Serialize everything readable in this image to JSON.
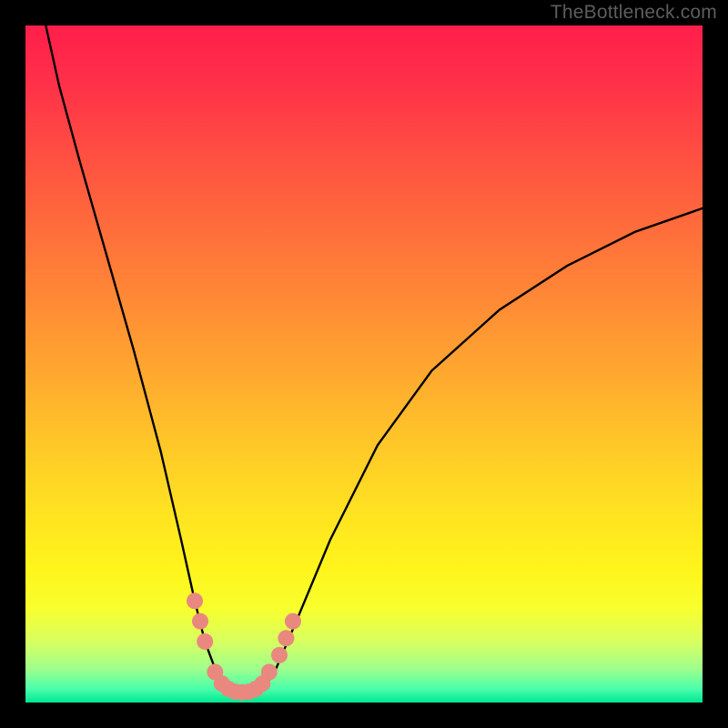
{
  "watermark": "TheBottleneck.com",
  "chart_data": {
    "type": "line",
    "title": "",
    "xlabel": "",
    "ylabel": "",
    "xlim": [
      0,
      100
    ],
    "ylim": [
      0,
      100
    ],
    "series": [
      {
        "name": "bottleneck-curve",
        "x": [
          3,
          5,
          8,
          12,
          16,
          20,
          23,
          25,
          26.5,
          28,
          29.5,
          31,
          32.5,
          34,
          35.5,
          37,
          40,
          45,
          52,
          60,
          70,
          80,
          90,
          100
        ],
        "values": [
          100,
          91,
          80,
          66,
          52,
          37,
          24,
          15,
          9,
          5,
          2.2,
          1.3,
          1.2,
          1.5,
          2.5,
          5,
          12,
          24,
          38,
          49,
          58,
          64.5,
          69.5,
          73
        ]
      }
    ],
    "markers": {
      "name": "highlight-dots",
      "color": "#e9887f",
      "points": [
        {
          "x": 25.0,
          "y": 15.0
        },
        {
          "x": 25.8,
          "y": 12.0
        },
        {
          "x": 26.5,
          "y": 9.0
        },
        {
          "x": 28.0,
          "y": 4.5
        },
        {
          "x": 29.0,
          "y": 2.8
        },
        {
          "x": 30.0,
          "y": 2.0
        },
        {
          "x": 31.0,
          "y": 1.6
        },
        {
          "x": 32.0,
          "y": 1.5
        },
        {
          "x": 33.0,
          "y": 1.6
        },
        {
          "x": 34.0,
          "y": 2.0
        },
        {
          "x": 35.0,
          "y": 2.8
        },
        {
          "x": 36.0,
          "y": 4.5
        },
        {
          "x": 37.5,
          "y": 7.0
        },
        {
          "x": 38.5,
          "y": 9.5
        },
        {
          "x": 39.5,
          "y": 12.0
        }
      ]
    }
  }
}
